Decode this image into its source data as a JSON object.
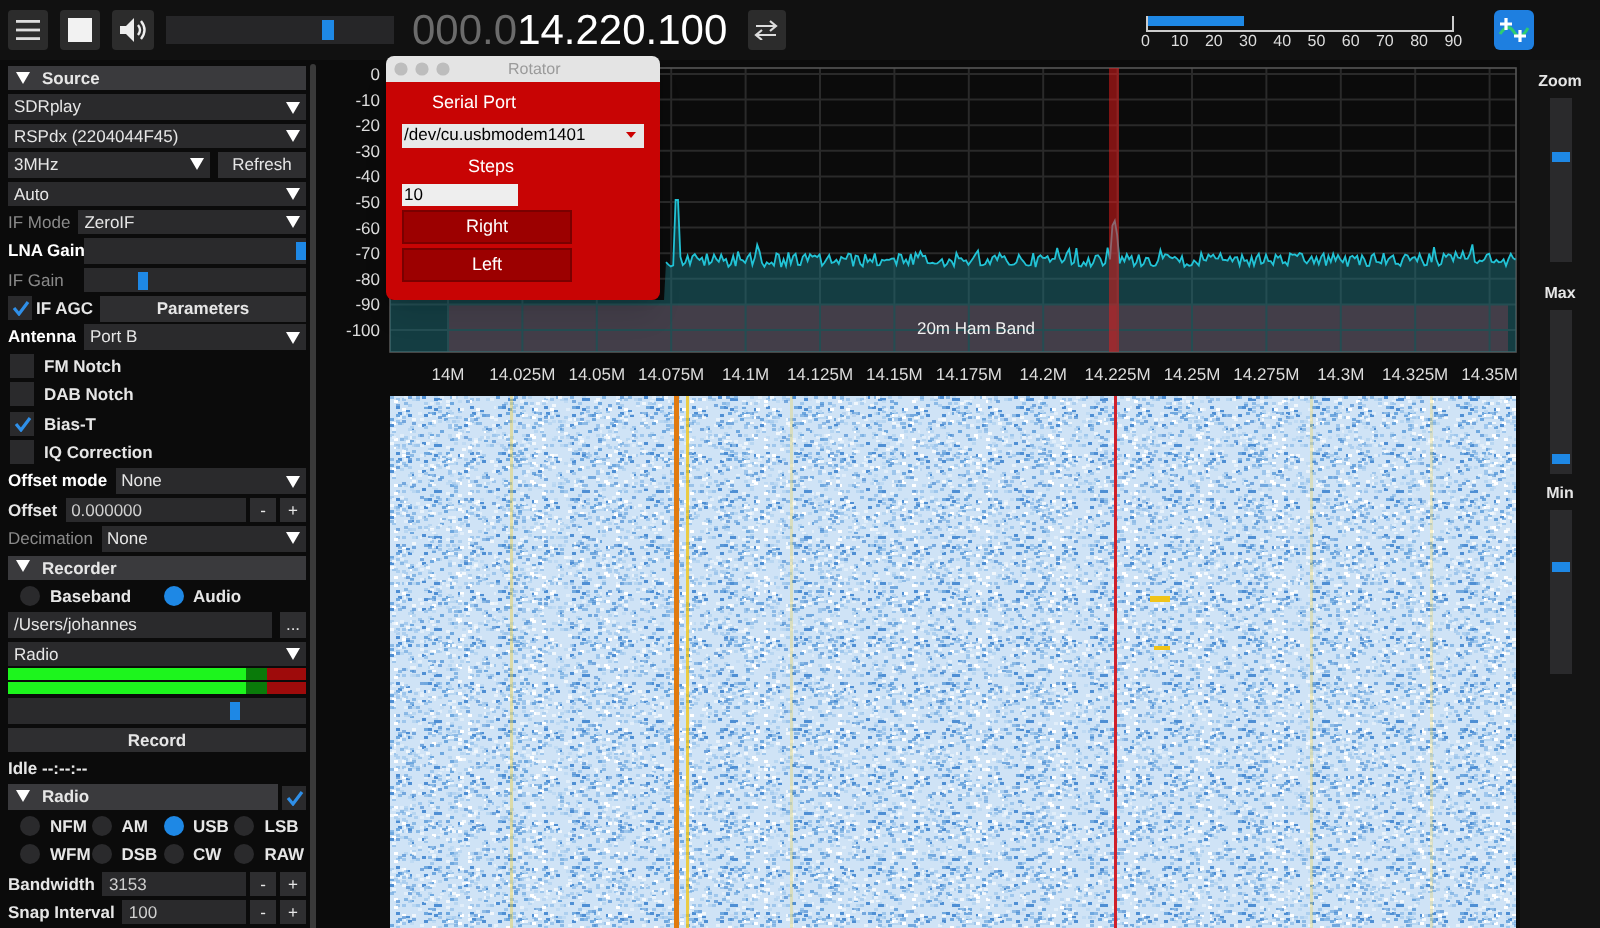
{
  "toolbar": {
    "volume": {
      "level": 0.72
    },
    "frequency": {
      "leading": "000.0",
      "value": "14.220.100"
    },
    "snr_meter": {
      "level": 0.32,
      "ticks": [
        "0",
        "10",
        "20",
        "30",
        "40",
        "50",
        "60",
        "70",
        "80",
        "90"
      ]
    }
  },
  "sidebar": {
    "rows": [
      {
        "kind": "header",
        "label": "Source",
        "expanded": true
      },
      {
        "kind": "dropdown",
        "value": "SDRplay"
      },
      {
        "kind": "dropdown",
        "value": "RSPdx (2204044F45)"
      },
      {
        "kind": "dropdown_button",
        "value": "3MHz",
        "button": "Refresh"
      },
      {
        "kind": "dropdown",
        "value": "Auto"
      },
      {
        "kind": "labeled_dropdown",
        "label": "IF Mode",
        "value": "ZeroIF",
        "disabled": true
      },
      {
        "kind": "slider",
        "label": "LNA Gain",
        "level": 1,
        "disabled": false
      },
      {
        "kind": "slider",
        "label": "IF Gain",
        "level": 0.25,
        "disabled": true
      },
      {
        "kind": "check_button",
        "label": "IF AGC",
        "checked": true,
        "button": "Parameters"
      },
      {
        "kind": "labeled_dropdown",
        "label": "Antenna",
        "value": "Port B",
        "disabled": false
      },
      {
        "kind": "checkbox",
        "label": "FM Notch",
        "checked": false
      },
      {
        "kind": "checkbox",
        "label": "DAB Notch",
        "checked": false
      },
      {
        "kind": "checkbox",
        "label": "Bias-T",
        "checked": true
      },
      {
        "kind": "checkbox",
        "label": "IQ Correction",
        "checked": false
      },
      {
        "kind": "labeled_dropdown",
        "label": "Offset mode",
        "value": "None",
        "disabled": false
      },
      {
        "kind": "stepper",
        "label": "Offset",
        "value": "0.000000",
        "minus": "-",
        "plus": "+"
      },
      {
        "kind": "labeled_dropdown",
        "label": "Decimation",
        "value": "None",
        "disabled": true
      },
      {
        "kind": "header",
        "label": "Recorder",
        "expanded": true
      },
      {
        "kind": "radio_row",
        "options": [
          {
            "label": "Baseband",
            "selected": false
          },
          {
            "label": "Audio",
            "selected": true
          }
        ]
      },
      {
        "kind": "path",
        "value": "/Users/johannes",
        "button": "..."
      },
      {
        "kind": "dropdown",
        "value": "Radio"
      },
      {
        "kind": "meter",
        "level": 0.8
      },
      {
        "kind": "meter",
        "level": 0.8
      },
      {
        "kind": "slider",
        "level": 0.77
      },
      {
        "kind": "button",
        "label": "Record"
      },
      {
        "kind": "status",
        "text": "Idle --:--:--"
      },
      {
        "kind": "header",
        "label": "Radio",
        "expanded": true,
        "checked": true
      },
      {
        "kind": "radio_grid",
        "options": [
          {
            "label": "NFM",
            "selected": false
          },
          {
            "label": "AM",
            "selected": false
          },
          {
            "label": "USB",
            "selected": true
          },
          {
            "label": "LSB",
            "selected": false
          },
          {
            "label": "WFM",
            "selected": false
          },
          {
            "label": "DSB",
            "selected": false
          },
          {
            "label": "CW",
            "selected": false
          },
          {
            "label": "RAW",
            "selected": false
          }
        ]
      },
      {
        "kind": "stepper",
        "label": "Bandwidth",
        "value": "3153",
        "minus": "-",
        "plus": "+"
      },
      {
        "kind": "stepper",
        "label": "Snap Interval",
        "value": "100",
        "minus": "-",
        "plus": "+"
      }
    ]
  },
  "spectrum": {
    "y_labels": [
      "0",
      "-10",
      "-20",
      "-30",
      "-40",
      "-50",
      "-60",
      "-70",
      "-80",
      "-90",
      "-100"
    ],
    "x_labels": [
      "14M",
      "14.025M",
      "14.05M",
      "14.075M",
      "14.1M",
      "14.125M",
      "14.15M",
      "14.175M",
      "14.2M",
      "14.225M",
      "14.25M",
      "14.275M",
      "14.3M",
      "14.325M",
      "14.35M"
    ],
    "band_label": "20m Ham Band"
  },
  "rotator": {
    "title": "Rotator",
    "serial_port_label": "Serial Port",
    "serial_port": "/dev/cu.usbmodem1401",
    "steps_label": "Steps",
    "steps": "10",
    "buttons": [
      "Right",
      "Left"
    ]
  },
  "right_panel": {
    "sliders": [
      {
        "label": "Zoom",
        "level": 0.65
      },
      {
        "label": "Max",
        "level": 0.06
      },
      {
        "label": "Min",
        "level": 0.66
      }
    ]
  }
}
